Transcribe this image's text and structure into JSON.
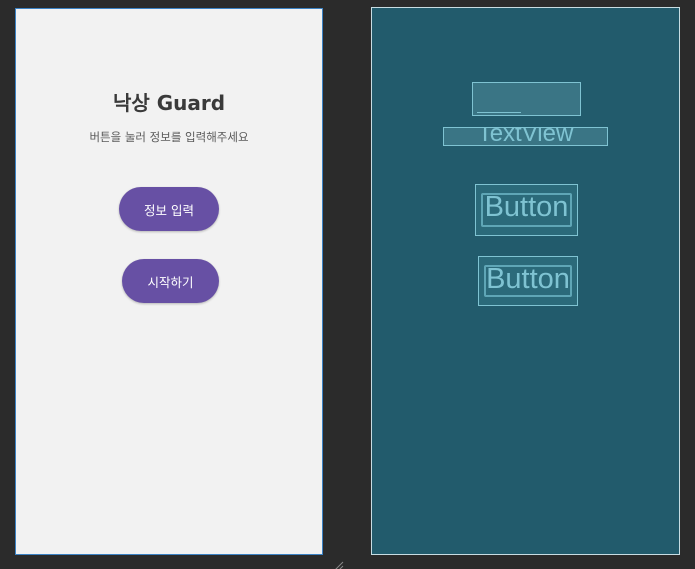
{
  "design": {
    "title": "낙상 Guard",
    "subtitle": "버튼을 눌러 정보를 입력해주세요",
    "buttons": {
      "info": "정보 입력",
      "start": "시작하기"
    }
  },
  "blueprint": {
    "textview_label": "TextView",
    "button1_label": "Button",
    "button2_label": "Button"
  },
  "colors": {
    "canvas_bg": "#2b2b2b",
    "design_bg": "#f2f2f2",
    "design_border": "#3b82c4",
    "button_purple": "#6750a4",
    "blueprint_bg": "#225b6c",
    "blueprint_line": "#7fc3d2"
  }
}
